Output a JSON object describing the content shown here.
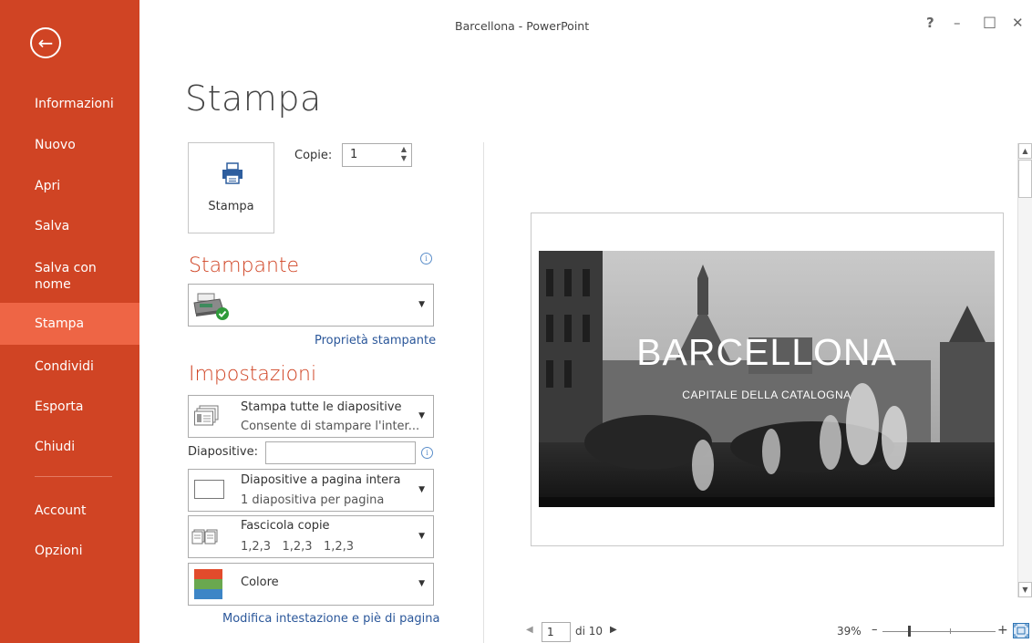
{
  "window": {
    "title": "Barcellona - PowerPoint",
    "help": "?",
    "minimize": "–",
    "maximize": "□",
    "close": "✕"
  },
  "sidebar": {
    "back_icon": "arrow-left-circle-icon",
    "items": [
      {
        "label": "Informazioni"
      },
      {
        "label": "Nuovo"
      },
      {
        "label": "Apri"
      },
      {
        "label": "Salva"
      },
      {
        "label": "Salva con nome"
      },
      {
        "label": "Stampa",
        "selected": true
      },
      {
        "label": "Condividi"
      },
      {
        "label": "Esporta"
      },
      {
        "label": "Chiudi"
      },
      {
        "label": "Account"
      },
      {
        "label": "Opzioni"
      }
    ],
    "colors": {
      "background": "#D04424",
      "selected": "#EE6545"
    }
  },
  "main": {
    "title": "Stampa",
    "print_button": {
      "label": "Stampa",
      "icon": "printer-icon"
    },
    "copies": {
      "label": "Copie:",
      "value": "1"
    },
    "printer_section": {
      "heading": "Stampante",
      "selected_printer_icon": "printer-ready-icon",
      "properties_link": "Proprietà stampante"
    },
    "settings_section": {
      "heading": "Impostazioni",
      "range": {
        "title": "Stampa tutte le diapositive",
        "subtitle": "Consente di stampare l'inter..."
      },
      "slides_label": "Diapositive:",
      "slides_value": "",
      "layout": {
        "title": "Diapositive a pagina intera",
        "subtitle": "1 diapositiva per pagina"
      },
      "collate": {
        "title": "Fascicola copie",
        "subtitle": "1,2,3   1,2,3   1,2,3"
      },
      "color": {
        "title": "Colore"
      },
      "header_footer_link": "Modifica intestazione e piè di pagina"
    }
  },
  "preview": {
    "slide_title": "BARCELLONA",
    "slide_subtitle": "CAPITALE DELLA CATALOGNA",
    "current_page": "1",
    "total_pages": "di 10",
    "zoom": "39%",
    "zoom_minus": "–",
    "zoom_plus": "+"
  },
  "accent_color": "#D04424",
  "link_color": "#2B579A"
}
